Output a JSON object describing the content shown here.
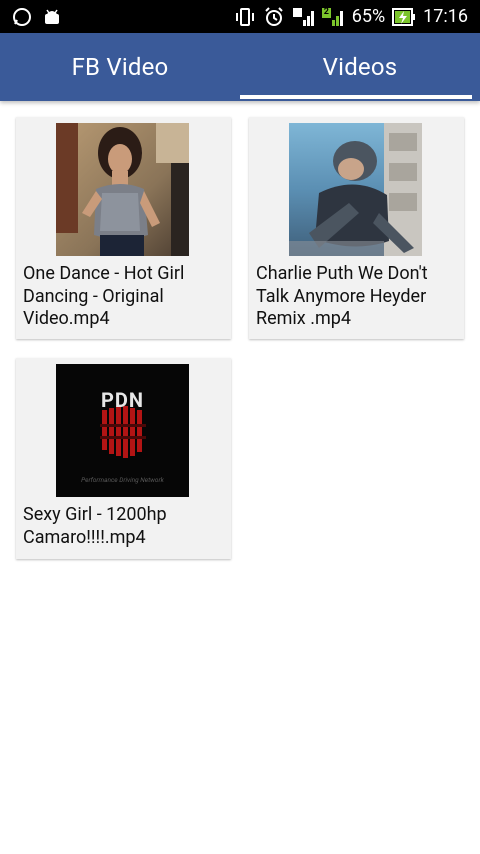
{
  "status_bar": {
    "battery": "65%",
    "time": "17:16",
    "sim2_label": "2"
  },
  "tabs": [
    {
      "label": "FB Video"
    },
    {
      "label": "Videos"
    }
  ],
  "videos": [
    {
      "title": "One Dance - Hot Girl Dancing - Original Video.mp4"
    },
    {
      "title": "Charlie Puth We Don't Talk Anymore Heyder Remix .mp4"
    },
    {
      "title": "Sexy Girl - 1200hp Camaro!!!!.mp4",
      "thumb_text": "PDN",
      "thumb_caption": "Performance Driving Network"
    }
  ],
  "colors": {
    "app_bar": "#3a5a99",
    "status_bar": "#000000",
    "card": "#f2f2f2",
    "battery_charging": "#7cc52c"
  }
}
